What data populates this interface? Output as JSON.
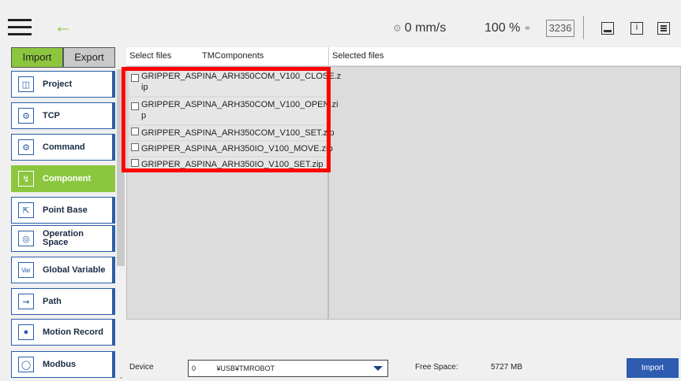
{
  "topbar": {
    "speed": "0 mm/s",
    "percent": "100 %",
    "counter": "3236"
  },
  "sidebar": {
    "tabs": [
      {
        "label": "Import",
        "active": true
      },
      {
        "label": "Export",
        "active": false
      }
    ],
    "items": [
      {
        "label": "Project",
        "icon": "project-icon",
        "active": false
      },
      {
        "label": "TCP",
        "icon": "tcp-icon",
        "active": false
      },
      {
        "label": "Command",
        "icon": "command-icon",
        "active": false
      },
      {
        "label": "Component",
        "icon": "component-icon",
        "active": true
      },
      {
        "label": "Point Base",
        "icon": "point-base-icon",
        "active": false
      },
      {
        "label": "Operation\nSpace",
        "icon": "operation-space-icon",
        "active": false
      },
      {
        "label": "Global Variable",
        "icon": "global-variable-icon",
        "active": false
      },
      {
        "label": "Path",
        "icon": "path-icon",
        "active": false
      },
      {
        "label": "Motion Record",
        "icon": "motion-record-icon",
        "active": false
      },
      {
        "label": "Modbus",
        "icon": "modbus-icon",
        "active": false
      }
    ]
  },
  "files_panel": {
    "select_label": "Select files",
    "folder_label": "TMComponents",
    "selected_label": "Selected files",
    "files": [
      {
        "line1": "GRIPPER_ASPINA_ARH350COM_V100_CLOSE.z",
        "line2": "ip"
      },
      {
        "line1": "GRIPPER_ASPINA_ARH350COM_V100_OPEN.zi",
        "line2": "p"
      },
      {
        "line1": "GRIPPER_ASPINA_ARH350COM_V100_SET.zip",
        "line2": ""
      },
      {
        "line1": "GRIPPER_ASPINA_ARH350IO_V100_MOVE.zip",
        "line2": ""
      },
      {
        "line1": "GRIPPER_ASPINA_ARH350IO_V100_SET.zip",
        "line2": ""
      }
    ]
  },
  "bottom": {
    "device_label": "Device",
    "device_index": "0",
    "device_path": "¥USB¥TMROBOT",
    "free_space_label": "Free Space:",
    "free_space_value": "5727 MB",
    "import_label": "Import"
  },
  "colors": {
    "accent_green": "#8cc63f",
    "nav_blue": "#2a5ea8",
    "highlight_red": "#ff0000",
    "button_blue": "#2d5cb0"
  }
}
